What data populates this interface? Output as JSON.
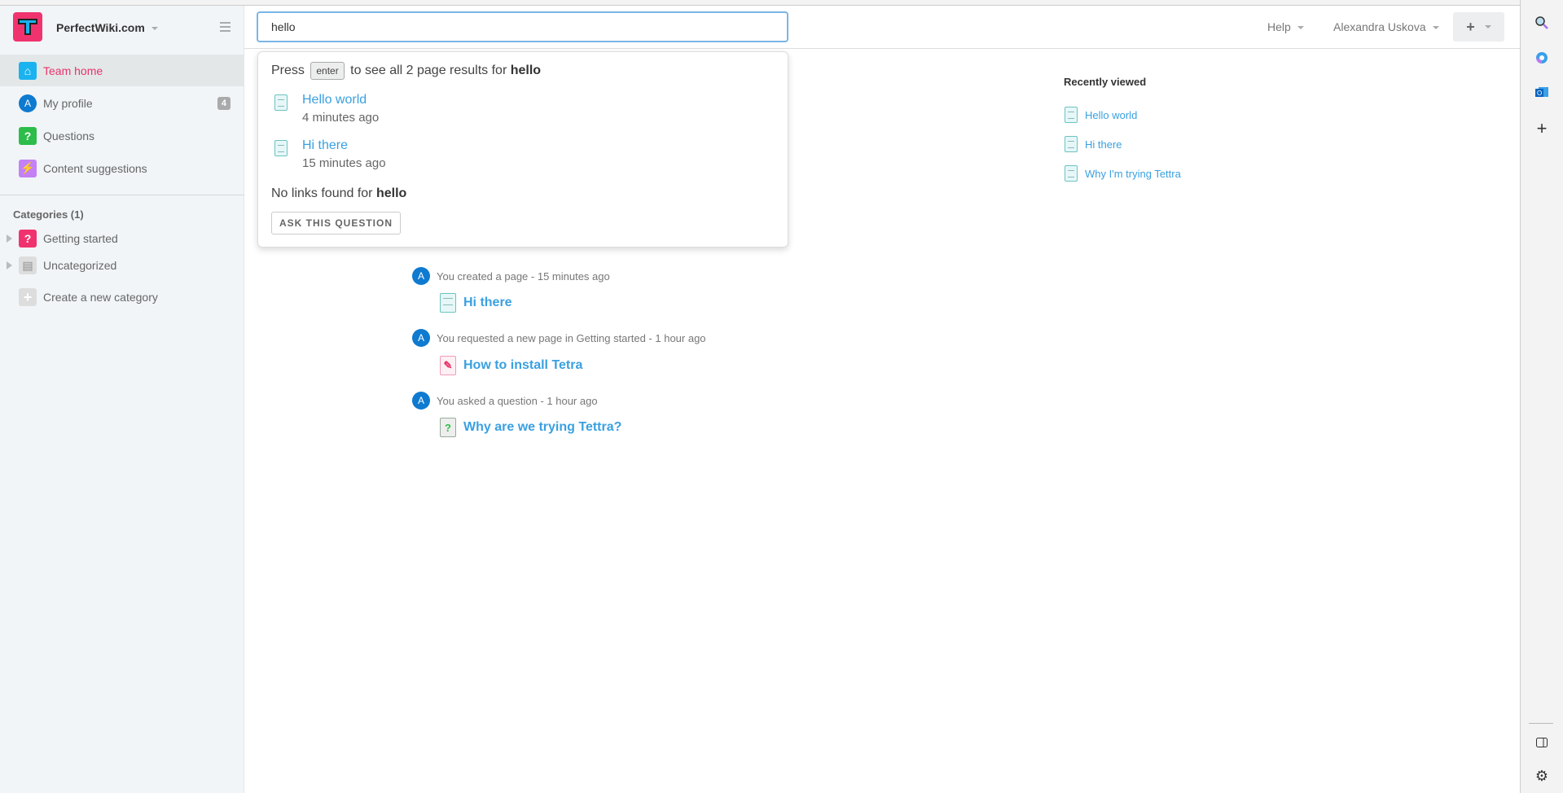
{
  "sidebar": {
    "brand": "PerfectWiki.com",
    "items": [
      {
        "label": "Team home",
        "icon": "home-icon",
        "color": "#1ab3f0"
      },
      {
        "label": "My profile",
        "icon": "avatar",
        "avatar_letter": "A",
        "badge": "4"
      },
      {
        "label": "Questions",
        "icon": "question-icon",
        "glyph": "?",
        "color": "#2dbd4a"
      },
      {
        "label": "Content suggestions",
        "icon": "lightning-icon",
        "glyph": "⚡",
        "color": "#c481f5"
      }
    ],
    "categories_title": "Categories (1)",
    "categories": [
      {
        "label": "Getting started",
        "glyph": "?",
        "color": "#f0336e"
      },
      {
        "label": "Uncategorized",
        "glyph": "▤",
        "color": "#ddd"
      }
    ],
    "create_category": "Create a new category"
  },
  "header": {
    "search_value": "hello",
    "help": "Help",
    "user": "Alexandra Uskova",
    "plus": "+"
  },
  "search_dropdown": {
    "press": "Press",
    "key": "enter",
    "summary": "to see all 2 page results for",
    "query": "hello",
    "results": [
      {
        "title": "Hello world",
        "time": "4 minutes ago"
      },
      {
        "title": "Hi there",
        "time": "15 minutes ago"
      }
    ],
    "no_links": "No links found for",
    "ask_button": "ASK THIS QUESTION"
  },
  "activity": [
    {
      "avatar": "A",
      "text": "You created a page - 15 minutes ago",
      "link": "Hi there",
      "type": "page"
    },
    {
      "avatar": "A",
      "text": "You requested a new page in Getting started - 1 hour ago",
      "link": "How to install Tetra",
      "type": "request"
    },
    {
      "avatar": "A",
      "text": "You asked a question - 1 hour ago",
      "link": "Why are we trying Tettra?",
      "type": "question"
    }
  ],
  "recently_viewed": {
    "title": "Recently viewed",
    "items": [
      "Hello world",
      "Hi there",
      "Why I'm trying Tettra"
    ]
  },
  "colors": {
    "accent": "#e8336a",
    "link": "#3aa0e0",
    "avatar": "#0e7ad0"
  }
}
